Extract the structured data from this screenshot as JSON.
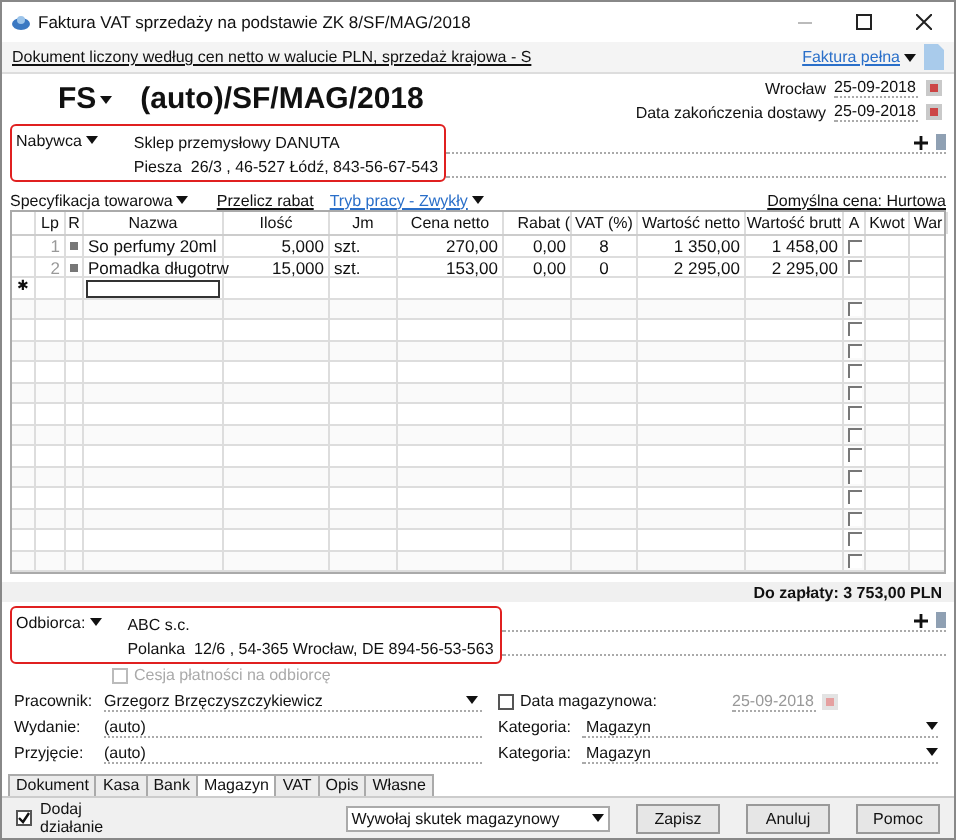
{
  "window": {
    "title": "Faktura VAT sprzedaży na podstawie ZK 8/SF/MAG/2018"
  },
  "info_bar": {
    "text": "Dokument liczony według cen netto w walucie PLN, sprzedaż krajowa - S",
    "document_type": "Faktura pełna"
  },
  "header": {
    "series": "FS",
    "number": "(auto)/SF/MAG/2018",
    "place": "Wrocław",
    "date": "25-09-2018",
    "delivery_label": "Data zakończenia dostawy",
    "delivery_date": "25-09-2018"
  },
  "buyer": {
    "label": "Nabywca",
    "name": "Sklep przemysłowy DANUTA",
    "address": "Piesza  26/3 , 46-527 Łódź, 843-56-67-543"
  },
  "toolbar": {
    "spec": "Specyfikacja towarowa",
    "recalc": "Przelicz rabat",
    "mode": "Tryb pracy - Zwykły",
    "default_price": "Domyślna cena: Hurtowa"
  },
  "table": {
    "columns": [
      "Lp",
      "R",
      "Nazwa",
      "Ilość",
      "Jm",
      "Cena netto",
      "Rabat (",
      "VAT (%)",
      "Wartość netto",
      "Wartość brutt",
      "A",
      "Kwot",
      "War"
    ],
    "rows": [
      {
        "cells": [
          "1",
          "",
          "So perfumy 20ml",
          "5,000",
          "szt.",
          "270,00",
          "0,00",
          "8",
          "1 350,00",
          "1 458,00"
        ],
        "a_checked": false
      },
      {
        "cells": [
          "2",
          "",
          "Pomadka długotrw",
          "15,000",
          "szt.",
          "153,00",
          "0,00",
          "0",
          "2 295,00",
          "2 295,00"
        ],
        "a_checked": false
      }
    ],
    "new_row_marker": "✱",
    "blank_rows": [
      {
        "a_checked": false
      },
      {
        "a_checked": false
      },
      {
        "a_checked": false
      },
      {
        "a_checked": false
      },
      {
        "a_checked": false
      },
      {
        "a_checked": false
      },
      {
        "a_checked": false
      },
      {
        "a_checked": false
      },
      {
        "a_checked": false
      },
      {
        "a_checked": false
      },
      {
        "a_checked": false
      },
      {
        "a_checked": false
      },
      {
        "a_checked": false
      }
    ]
  },
  "total": "Do zapłaty: 3 753,00 PLN",
  "recipient": {
    "label": "Odbiorca:",
    "name": "ABC s.c.",
    "address": "Polanka  12/6 , 54-365 Wrocław, DE 894-56-53-563"
  },
  "cession": {
    "label": "Cesja płatności na odbiorcę",
    "checked": false,
    "disabled": true
  },
  "fields": [
    {
      "label": "Pracownik:",
      "value": "Grzegorz Brzęczyszczykiewicz",
      "dropdown": true
    },
    {
      "label": "Wydanie:",
      "value": "(auto)",
      "dropdown": false
    },
    {
      "label": "Przyjęcie:",
      "value": "(auto)",
      "dropdown": false
    }
  ],
  "warehouse_date": {
    "label": "Data magazynowa:",
    "checked": false,
    "value": "25-09-2018"
  },
  "categories": [
    {
      "label": "Kategoria:",
      "value": "Magazyn"
    },
    {
      "label": "Kategoria:",
      "value": "Magazyn"
    }
  ],
  "tabs": [
    {
      "label": "Dokument",
      "selected": false
    },
    {
      "label": "Kasa",
      "selected": false
    },
    {
      "label": "Bank",
      "selected": false
    },
    {
      "label": "Magazyn",
      "selected": true
    },
    {
      "label": "VAT",
      "selected": false
    },
    {
      "label": "Opis",
      "selected": false
    },
    {
      "label": "Własne",
      "selected": false
    }
  ],
  "bottom": {
    "add_action": {
      "label": "Dodaj działanie",
      "checked": true
    },
    "action": "Wywołaj skutek magazynowy",
    "buttons": [
      "Zapisz",
      "Anuluj",
      "Pomoc"
    ]
  }
}
